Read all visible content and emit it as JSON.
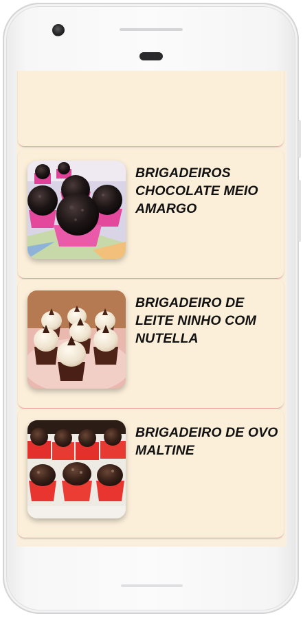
{
  "recipes": [
    {
      "title": "BRIGADEIROS CHOCOLATE MEIO AMARGO",
      "image_desc": "chocolate-brigadeiros-pink-cups"
    },
    {
      "title": "BRIGADEIRO DE LEITE NINHO COM NUTELLA",
      "image_desc": "white-brigadeiros-nutella-tops"
    },
    {
      "title": "BRIGADEIRO DE OVO MALTINE",
      "image_desc": "brigadeiros-red-cups"
    }
  ],
  "colors": {
    "screen_bg": "#f9efdc",
    "card_bg": "#fbefda",
    "card_divider": "#e9a6a0",
    "title_text": "#111111"
  }
}
